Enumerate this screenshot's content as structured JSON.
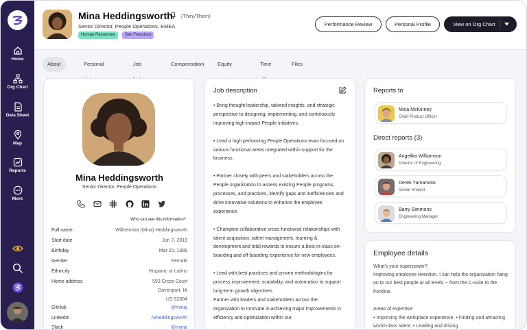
{
  "sidebar": {
    "items": [
      {
        "label": "Home",
        "icon": "home-icon"
      },
      {
        "label": "Org Chart",
        "icon": "org-chart-icon"
      },
      {
        "label": "Data Sheet",
        "icon": "data-sheet-icon"
      },
      {
        "label": "Map",
        "icon": "map-pin-icon"
      },
      {
        "label": "Reports",
        "icon": "reports-icon"
      },
      {
        "label": "More",
        "icon": "more-icon"
      }
    ]
  },
  "header": {
    "name": "Mina Heddingsworth",
    "pronouns": "(They/Them)",
    "title": "Senior Director, People Operations, EMEA",
    "tags": [
      "Human Resources",
      "San Francisco"
    ],
    "tag_colors": [
      "#7ce0c3",
      "#b9a7f5"
    ],
    "buttons": {
      "performance_review": "Performance Review",
      "personal_profile": "Personal Profile",
      "view_org_chart": "View on Org Chart"
    }
  },
  "tabs": [
    "About me",
    "Personal history",
    "Job history",
    "Compensation",
    "Equity grants",
    "Time off",
    "Files"
  ],
  "profile": {
    "name": "Mina Heddingsworth",
    "title": "Senior Director, People Operations",
    "who_can_see": "Who can see this information?",
    "fields": [
      {
        "key": "Full name",
        "value": "Wilhelmina (Mina) Heddingsworth"
      },
      {
        "key": "Start date",
        "value": "Jun 7, 2019"
      },
      {
        "key": "Birthday",
        "value": "Mar 20, 1988"
      },
      {
        "key": "Gender",
        "value": "Female"
      },
      {
        "key": "Ethnicity",
        "value": "Hispanic or Latino"
      },
      {
        "key": "Home address",
        "value": "593 Cross Court"
      },
      {
        "key": "",
        "value": "Davenport, IA"
      },
      {
        "key": "",
        "value": "US 52804"
      },
      {
        "key": "GitHub",
        "value": "@minaj"
      },
      {
        "key": "LinkedIn",
        "value": "/wheddingsworth"
      },
      {
        "key": "Slack",
        "value": "@minaj"
      }
    ]
  },
  "job_description": {
    "heading": "Job description",
    "paragraphs": [
      "• Bring thought leadership, tailored insights, and strategic perspective to designing, implementing, and continuously improving high-impact People initiatives.",
      "• Lead a high performing People Operations team focused on various functional areas integrated within support for the business.",
      "• Partner closely with peers and stakeholders across the People organization to assess existing People programs, processes, and practices, identify gaps and inefficiencies and drive innovative solutions to enhance the employee experience.",
      "• Champion collaborative cross-functional relationships with talent acquisition, talent management, learning & development and total rewards to ensure a best-in-class on-boarding and off-boarding experience for new employees.",
      "•  Lead with best practices and proven methodologies for process improvement, scalability, and automation to support long-term growth objectives.",
      "Partner with leaders and stakeholders across the organization to innovate in achieving major improvements in efficiency and optimization within our"
    ]
  },
  "reports_to": {
    "heading": "Reports to",
    "person": {
      "name": "Mina McKinney",
      "role": "Chief Product Officer"
    }
  },
  "direct_reports": {
    "heading": "Direct reports (3)",
    "people": [
      {
        "name": "Angelika Williamson",
        "role": "Director of Engineering"
      },
      {
        "name": "Derek Yamamoto",
        "role": "Senior Analyst"
      },
      {
        "name": "Barry Simmons",
        "role": "Engineering Manager"
      }
    ]
  },
  "employee_details": {
    "heading": "Employee details",
    "superpower_q": "What's your superpower?",
    "superpower_a": "Improving employee retention. I can help the organization hang on to our best people at all levels -- from the C-suite to the frontline.",
    "expertise_q": "Areas of expertise:",
    "expertise_a": "• Improving the workplace experience. • Finding and attracting world-class talent. • Leading and driving"
  }
}
